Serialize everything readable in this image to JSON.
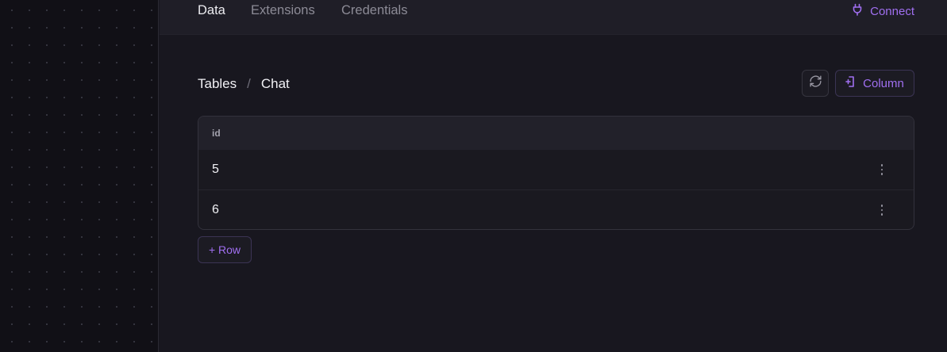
{
  "topbar": {
    "tabs": [
      {
        "label": "Data",
        "active": true
      },
      {
        "label": "Extensions",
        "active": false
      },
      {
        "label": "Credentials",
        "active": false
      }
    ],
    "connect_label": "Connect",
    "connect_icon": "plug-icon"
  },
  "breadcrumb": {
    "root": "Tables",
    "separator": "/",
    "current": "Chat"
  },
  "toolbar": {
    "refresh_icon": "refresh-icon",
    "column_icon": "column-add-icon",
    "column_label": "Column"
  },
  "table": {
    "columns": [
      "id"
    ],
    "rows": [
      {
        "id": "5"
      },
      {
        "id": "6"
      }
    ]
  },
  "add_row_label": "+ Row",
  "colors": {
    "accent": "#a06ff0",
    "background": "#18171f",
    "topbar": "#1f1e27",
    "sidebar": "#111016"
  }
}
